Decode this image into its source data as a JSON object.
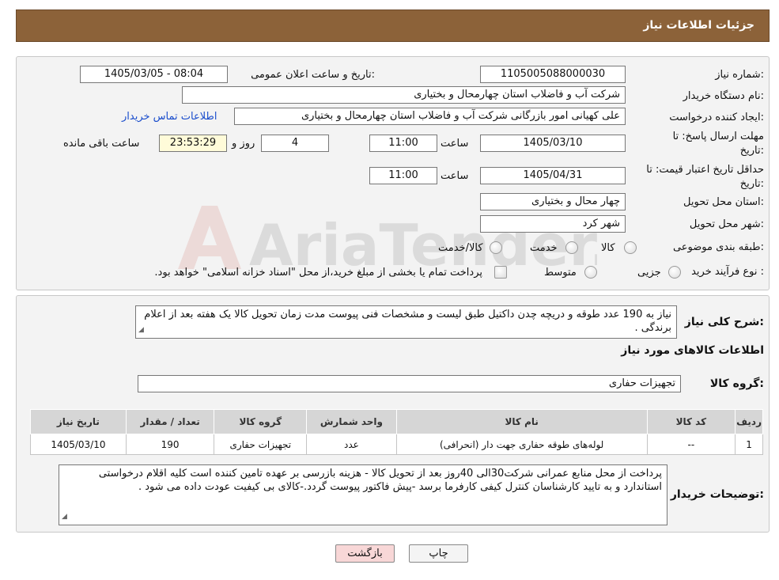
{
  "header": {
    "title": "جزئیات اطلاعات نیاز"
  },
  "form": {
    "need_number_label": "شماره نیاز:",
    "need_number": "1105005088000030",
    "announce_label": "تاریخ و ساعت اعلان عمومی:",
    "announce_value": "1405/03/05 - 08:04",
    "buyer_org_label": "نام دستگاه خریدار:",
    "buyer_org": "شرکت آب و فاضلاب استان چهارمحال و بختیاری",
    "requester_label": "ایجاد کننده درخواست:",
    "requester": "علی کهیانی امور بازرگانی شرکت آب و فاضلاب استان چهارمحال و بختیاری",
    "contact_link": "اطلاعات تماس خریدار",
    "reply_deadline_label_1": "مهلت ارسال پاسخ: تا",
    "reply_deadline_label_2": "تاریخ:",
    "reply_date": "1405/03/10",
    "time_label": "ساعت",
    "reply_time": "11:00",
    "days_value": "4",
    "days_label": "روز و",
    "remaining_time": "23:53:29",
    "remaining_label": "ساعت باقی مانده",
    "price_validity_label_1": "حداقل تاریخ اعتبار قیمت: تا",
    "price_validity_label_2": "تاریخ:",
    "validity_date": "1405/04/31",
    "validity_time": "11:00",
    "province_label": "استان محل تحویل:",
    "province": "چهار محال و بختیاری",
    "city_label": "شهر محل تحویل:",
    "city": "شهر کرد",
    "category_label": "طبقه بندی موضوعی:",
    "category_options": [
      "کالا",
      "خدمت",
      "کالا/خدمت"
    ],
    "process_label": "نوع فرآیند خرید :",
    "process_options": [
      "جزیی",
      "متوسط"
    ],
    "process_note": "پرداخت تمام یا بخشی از مبلغ خرید،از محل \"اسناد خزانه اسلامی\" خواهد بود."
  },
  "summary": {
    "label": "شرح کلی نیاز:",
    "text": "نیاز به 190 عدد طوقه و دریچه چدن داکتیل طبق لیست و مشخصات فنی پیوست مدت زمان تحویل کالا یک هفته بعد از اعلام برندگی ."
  },
  "goods_info_title": "اطلاعات کالاهای مورد نیاز",
  "goods_group": {
    "label": "گروه کالا:",
    "value": "تجهیزات حفاری"
  },
  "table": {
    "headers": [
      "ردیف",
      "کد کالا",
      "نام کالا",
      "واحد شمارش",
      "گروه کالا",
      "تعداد / مقدار",
      "تاریخ نیاز"
    ],
    "rows": [
      [
        "1",
        "--",
        "لوله‌های طوقه حفاری جهت دار (انحرافی)",
        "عدد",
        "تجهیزات حفاری",
        "190",
        "1405/03/10"
      ]
    ]
  },
  "buyer_notes": {
    "label": "توضیحات خریدار:",
    "text": "پرداخت از محل منابع عمرانی شرکت30الی 40روز بعد از تحویل کالا    - هزینه بازرسی بر عهده تامین کننده است کلیه اقلام درخواستی استاندارد و به تایید کارشناسان کنترل کیفی کارفرما برسد -پیش فاکتور پیوست گردد.-کالای بی کیفیت عودت داده می شود ."
  },
  "buttons": {
    "print": "چاپ",
    "back": "بازگشت"
  },
  "watermark": {
    "text": "AriaTender.neT"
  },
  "colors": {
    "header": "#8c6239",
    "link": "#1a4dcc",
    "back_button": "#f8d7d7"
  }
}
